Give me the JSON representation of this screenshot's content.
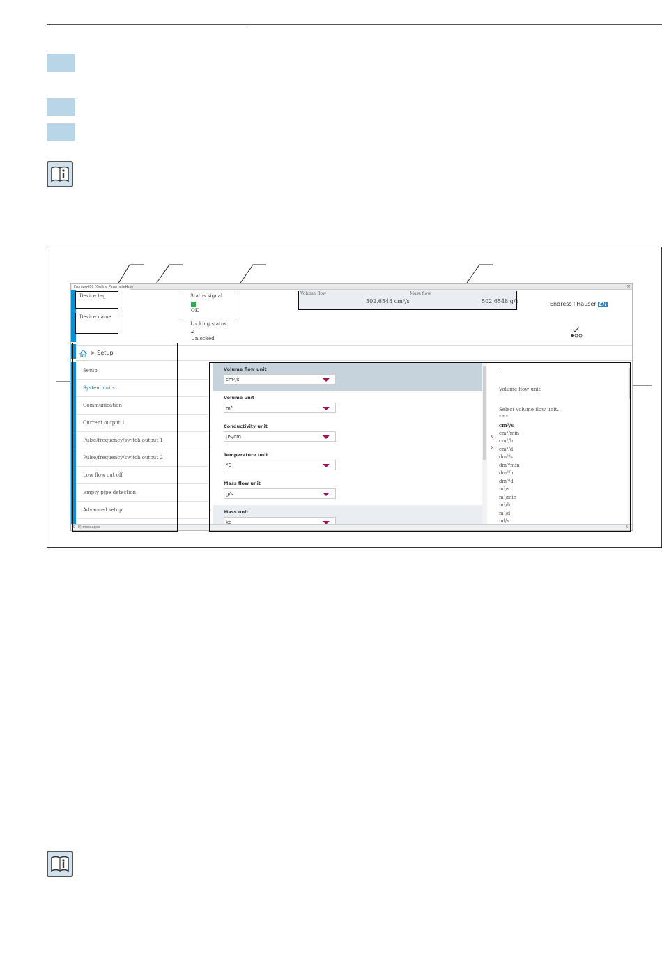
{
  "app": {
    "tab_title": "Promag400 (Online Parameterize)",
    "tab_close": "×",
    "window_close": "×"
  },
  "header": {
    "device_tag": "Device tag",
    "device_name": "Device name",
    "status_signal_label": "Status signal",
    "status_signal_value": "OK",
    "locking_status_label": "Locking status",
    "locking_status_value": "Unlocked",
    "volume_flow_label": "Volume flow",
    "volume_flow_value": "502.6548 cm³/s",
    "mass_flow_label": "Mass flow",
    "mass_flow_value": "502.6548 g/s",
    "logo_text": "Endress+Hauser",
    "logo_badge": "EH"
  },
  "breadcrumb": {
    "text": "> Setup"
  },
  "nav": {
    "items": [
      {
        "label": "Setup",
        "active": false
      },
      {
        "label": "System units",
        "active": true
      },
      {
        "label": "Communication",
        "active": false
      },
      {
        "label": "Current output 1",
        "active": false
      },
      {
        "label": "Pulse/frequency/switch output 1",
        "active": false
      },
      {
        "label": "Pulse/frequency/switch output 2",
        "active": false
      },
      {
        "label": "Low flow cut off",
        "active": false
      },
      {
        "label": "Empty pipe detection",
        "active": false
      },
      {
        "label": "Advanced setup",
        "active": false
      }
    ]
  },
  "form": {
    "fields": [
      {
        "label": "Volume flow unit",
        "value": "cm³/s"
      },
      {
        "label": "Volume unit",
        "value": "m³"
      },
      {
        "label": "Conductivity unit",
        "value": "µS/cm"
      },
      {
        "label": "Temperature unit",
        "value": "°C"
      },
      {
        "label": "Mass flow unit",
        "value": "g/s"
      },
      {
        "label": "Mass unit",
        "value": "kg"
      }
    ]
  },
  "help": {
    "dots_top": "..",
    "title": "Volume flow unit",
    "description": "Select volume flow unit.",
    "separator": "* * *",
    "options": [
      "cm³/s",
      "cm³/min",
      "cm³/h",
      "cm³/d",
      "dm³/s",
      "dm³/min",
      "dm³/h",
      "dm³/d",
      "m³/s",
      "m³/min",
      "m³/h",
      "m³/d",
      "ml/s"
    ]
  },
  "statusbar": {
    "left": "0 (0) messages",
    "right": "6"
  },
  "colors": {
    "accent_blue": "#0092d7",
    "dropdown_arrow": "#a1125b",
    "status_ok": "#2fab4e",
    "highlight_block": "#b9d6e8"
  }
}
